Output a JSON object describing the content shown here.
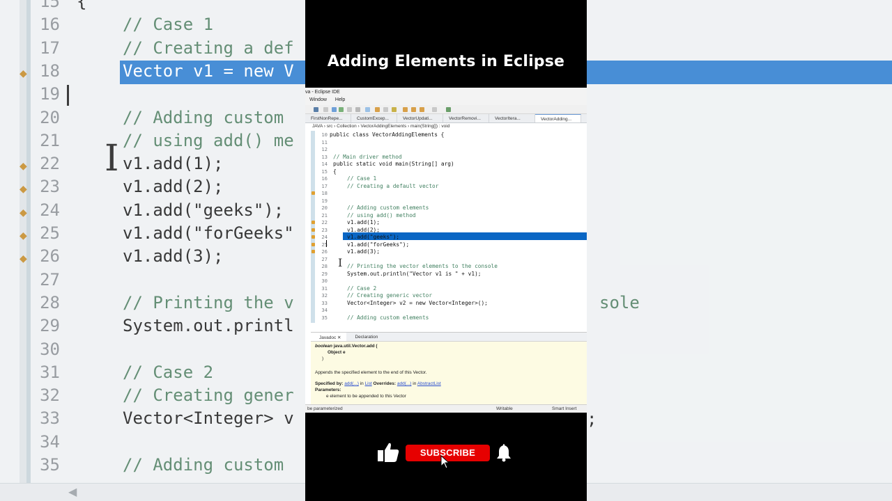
{
  "video_title": "Adding Elements in Eclipse",
  "background_editor": {
    "lines": [
      {
        "no": "15",
        "text": "{"
      },
      {
        "no": "16",
        "text": "// Case 1"
      },
      {
        "no": "17",
        "text": "// Creating a def"
      },
      {
        "no": "18",
        "text": "Vector v1 = new V"
      },
      {
        "no": "19",
        "text": ""
      },
      {
        "no": "20",
        "text": "// Adding custom"
      },
      {
        "no": "21",
        "text": "// using add() me"
      },
      {
        "no": "22",
        "text": "v1.add(1);"
      },
      {
        "no": "23",
        "text": "v1.add(2);"
      },
      {
        "no": "24",
        "text": "v1.add(\"geeks\");"
      },
      {
        "no": "25",
        "text": "v1.add(\"forGeeks\""
      },
      {
        "no": "26",
        "text": "v1.add(3);"
      },
      {
        "no": "27",
        "text": ""
      },
      {
        "no": "28",
        "text": "// Printing the v"
      },
      {
        "no": "29",
        "text": "System.out.printl"
      },
      {
        "no": "30",
        "text": ""
      },
      {
        "no": "31",
        "text": "// Case 2"
      },
      {
        "no": "32",
        "text": "// Creating gener"
      },
      {
        "no": "33",
        "text": "Vector<Integer> v"
      },
      {
        "no": "34",
        "text": ""
      },
      {
        "no": "35",
        "text": "// Adding custom"
      }
    ],
    "right_fragments": {
      "line28": "sole",
      "line33": ";"
    }
  },
  "eclipse": {
    "window_title": "va - Eclipse IDE",
    "menu": [
      "Window",
      "Help"
    ],
    "tabs": [
      "FirstNonRepe...",
      "CustomExcep...",
      "VectorUpdati...",
      "VectorRemovi...",
      "VectorItera...",
      "VectorAdding..."
    ],
    "breadcrumb": "JAVA  ›  src  ›  Collection  ›  VectorAddingElements  ›  main(String[]) : void",
    "code": [
      {
        "no": "10",
        "text": "public class VectorAddingElements {"
      },
      {
        "no": "11",
        "text": ""
      },
      {
        "no": "12",
        "text": ""
      },
      {
        "no": "13",
        "text": "// Main driver method"
      },
      {
        "no": "14",
        "text": "public static void main(String[] arg)"
      },
      {
        "no": "15",
        "text": "{"
      },
      {
        "no": "16",
        "text": "// Case 1"
      },
      {
        "no": "17",
        "text": "// Creating a default vector"
      },
      {
        "no": "18",
        "text": "Vector v1 = new Vector();"
      },
      {
        "no": "19",
        "text": ""
      },
      {
        "no": "20",
        "text": "// Adding custom elements"
      },
      {
        "no": "21",
        "text": "// using add() method"
      },
      {
        "no": "22",
        "text": "v1.add(1);"
      },
      {
        "no": "23",
        "text": "v1.add(2);"
      },
      {
        "no": "24",
        "text": "v1.add(\"geeks\");"
      },
      {
        "no": "25",
        "text": "v1.add(\"forGeeks\");"
      },
      {
        "no": "26",
        "text": "v1.add(3);"
      },
      {
        "no": "27",
        "text": ""
      },
      {
        "no": "28",
        "text": "// Printing the vector elements to the console"
      },
      {
        "no": "29",
        "text": "System.out.println(\"Vector v1 is \" + v1);"
      },
      {
        "no": "30",
        "text": ""
      },
      {
        "no": "31",
        "text": "// Case 2"
      },
      {
        "no": "32",
        "text": "// Creating generic vector"
      },
      {
        "no": "33",
        "text": "Vector<Integer> v2 = new Vector<Integer>();"
      },
      {
        "no": "34",
        "text": ""
      },
      {
        "no": "35",
        "text": "// Adding custom elements"
      }
    ],
    "bottom_tabs": [
      "Javadoc",
      "Declaration"
    ],
    "javadoc": {
      "signature_kw": "boolean",
      "signature": "java.util.Vector.add (",
      "param": "Object e",
      "close": ")",
      "description": "Appends the specified element to the end of this Vector.",
      "specified_by_label": "Specified by:",
      "specified_by_link": "add(...)",
      "in_label": "in",
      "list_link": "List",
      "overrides_label": "Overrides:",
      "overrides_link": "add(...)",
      "abstract_link": "AbstractList",
      "params_label": "Parameters:",
      "param_desc": "e element to be appended to this Vector"
    },
    "status": {
      "left": "be parameterized",
      "mode": "Writable",
      "insert": "Smart Insert"
    }
  },
  "subscribe_label": "SUBSCRIBE",
  "colors": {
    "subscribe": "#e60000",
    "selection": "#0a66c4",
    "keyword": "#7f0055",
    "comment": "#3f7f5f"
  }
}
